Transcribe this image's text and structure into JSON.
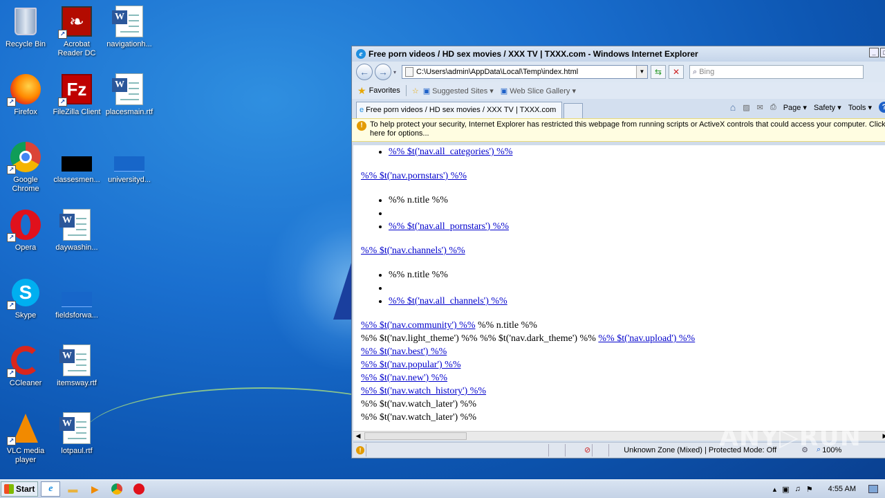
{
  "desktop": {
    "icons": [
      {
        "label": "Recycle Bin",
        "icon": "recycle-bin-icon"
      },
      {
        "label": "Acrobat Reader DC",
        "icon": "acrobat-icon"
      },
      {
        "label": "navigationh...",
        "icon": "word-document-icon"
      },
      {
        "label": "Firefox",
        "icon": "firefox-icon"
      },
      {
        "label": "FileZilla Client",
        "icon": "filezilla-icon"
      },
      {
        "label": "placesmain.rtf",
        "icon": "word-document-icon"
      },
      {
        "label": "Google Chrome",
        "icon": "chrome-icon"
      },
      {
        "label": "classesmen...",
        "icon": "black-file-icon"
      },
      {
        "label": "universityd...",
        "icon": "blue-file-icon"
      },
      {
        "label": "Opera",
        "icon": "opera-icon"
      },
      {
        "label": "daywashin...",
        "icon": "word-document-icon"
      },
      {
        "label": "Skype",
        "icon": "skype-icon"
      },
      {
        "label": "fieldsforwa...",
        "icon": "blue-file-icon"
      },
      {
        "label": "CCleaner",
        "icon": "ccleaner-icon"
      },
      {
        "label": "itemsway.rtf",
        "icon": "word-document-icon"
      },
      {
        "label": "VLC media player",
        "icon": "vlc-icon"
      },
      {
        "label": "lotpaul.rtf",
        "icon": "word-document-icon"
      }
    ]
  },
  "browser": {
    "title": "Free porn videos / HD sex movies / XXX TV | TXXX.com - Windows Internet Explorer",
    "address": "C:\\Users\\admin\\AppData\\Local\\Temp\\index.html",
    "search_placeholder": "Bing",
    "favorites": {
      "label": "Favorites",
      "items": [
        "Suggested Sites ▾",
        "Web Slice Gallery ▾"
      ]
    },
    "tab_title": "Free porn videos / HD sex movies / XXX TV | TXXX.com",
    "command_bar": {
      "page": "Page ▾",
      "safety": "Safety ▾",
      "tools": "Tools ▾"
    },
    "info_bar": "To help protect your security, Internet Explorer has restricted this webpage from running scripts or ActiveX controls that could access your computer. Click here for options...",
    "status": {
      "zone": "Unknown Zone (Mixed) | Protected Mode: Off",
      "zoom": "100%"
    }
  },
  "page": {
    "list1": {
      "link": "%% $t('nav.all_categories') %%"
    },
    "pornstars_link": "%% $t('nav.pornstars') %%",
    "list2": {
      "item1": "%% n.title %%",
      "item2": "",
      "link": "%% $t('nav.all_pornstars') %%"
    },
    "channels_link": "%% $t('nav.channels') %%",
    "list3": {
      "item1": "%% n.title %%",
      "item2": "",
      "link": "%% $t('nav.all_channels') %%"
    },
    "community_link": "%% $t('nav.community') %%",
    "community_text": " %% n.title %%",
    "theme_text": "%% $t('nav.light_theme') %% %% $t('nav.dark_theme') %% ",
    "upload_link": "%% $t('nav.upload') %%",
    "links": [
      "%% $t('nav.best') %%",
      "%% $t('nav.popular') %%",
      "%% $t('nav.new') %%",
      "%% $t('nav.watch_history') %%"
    ],
    "watch_later_1": "%% $t('nav.watch_later') %%",
    "watch_later_2": "%% $t('nav.watch_later') %%"
  },
  "taskbar": {
    "start_label": "Start",
    "clock": "4:55 AM"
  },
  "watermark": "ANY▷RUN"
}
